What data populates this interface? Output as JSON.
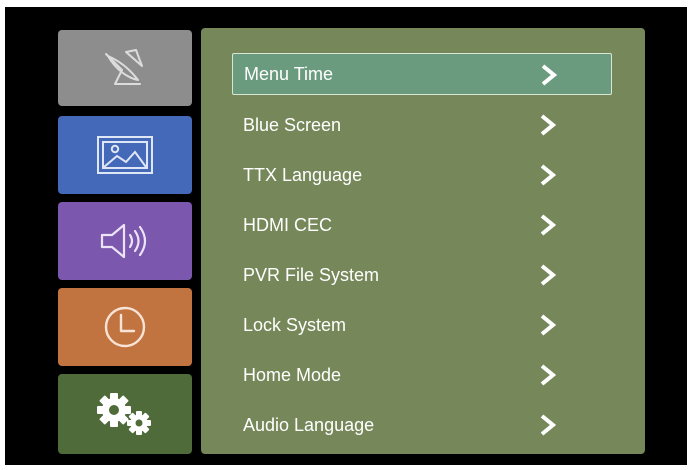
{
  "colors": {
    "background": "#000000",
    "panel": "#76885a",
    "selected_item": "#6b9b7e",
    "tab_satellite": "#8d8d8d",
    "tab_picture": "#4469b8",
    "tab_sound": "#7b57ad",
    "tab_time": "#c27440",
    "tab_setup": "#4e6b39"
  },
  "sidebar": {
    "tabs": [
      {
        "icon": "satellite-dish-icon",
        "active": false
      },
      {
        "icon": "picture-icon",
        "active": false
      },
      {
        "icon": "sound-icon",
        "active": false
      },
      {
        "icon": "clock-icon",
        "active": false
      },
      {
        "icon": "gears-icon",
        "active": true
      }
    ]
  },
  "menu": {
    "selected_index": 0,
    "items": [
      {
        "label": "Menu Time"
      },
      {
        "label": "Blue Screen"
      },
      {
        "label": "TTX Language"
      },
      {
        "label": "HDMI CEC"
      },
      {
        "label": "PVR File System"
      },
      {
        "label": "Lock System"
      },
      {
        "label": "Home Mode"
      },
      {
        "label": "Audio Language"
      }
    ]
  }
}
